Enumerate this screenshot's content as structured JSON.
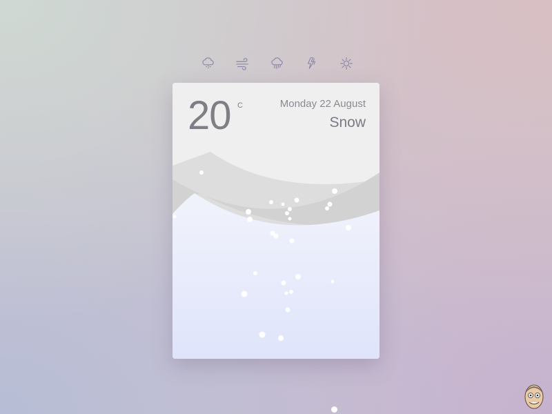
{
  "nav": {
    "items": [
      {
        "name": "snow",
        "icon": "snow-cloud-icon"
      },
      {
        "name": "wind",
        "icon": "wind-icon"
      },
      {
        "name": "rain",
        "icon": "rain-cloud-icon"
      },
      {
        "name": "thunder",
        "icon": "lightning-icon"
      },
      {
        "name": "sun",
        "icon": "sun-icon"
      }
    ],
    "icon_color": "#8b86a8"
  },
  "card": {
    "temperature": "20",
    "unit": "C",
    "date": "Monday 22 August",
    "condition": "Snow"
  },
  "colors": {
    "card_top": "#efefef",
    "hill_back": "#dddddd",
    "hill_front": "#d2d2d2",
    "snowflake": "#ffffff"
  }
}
